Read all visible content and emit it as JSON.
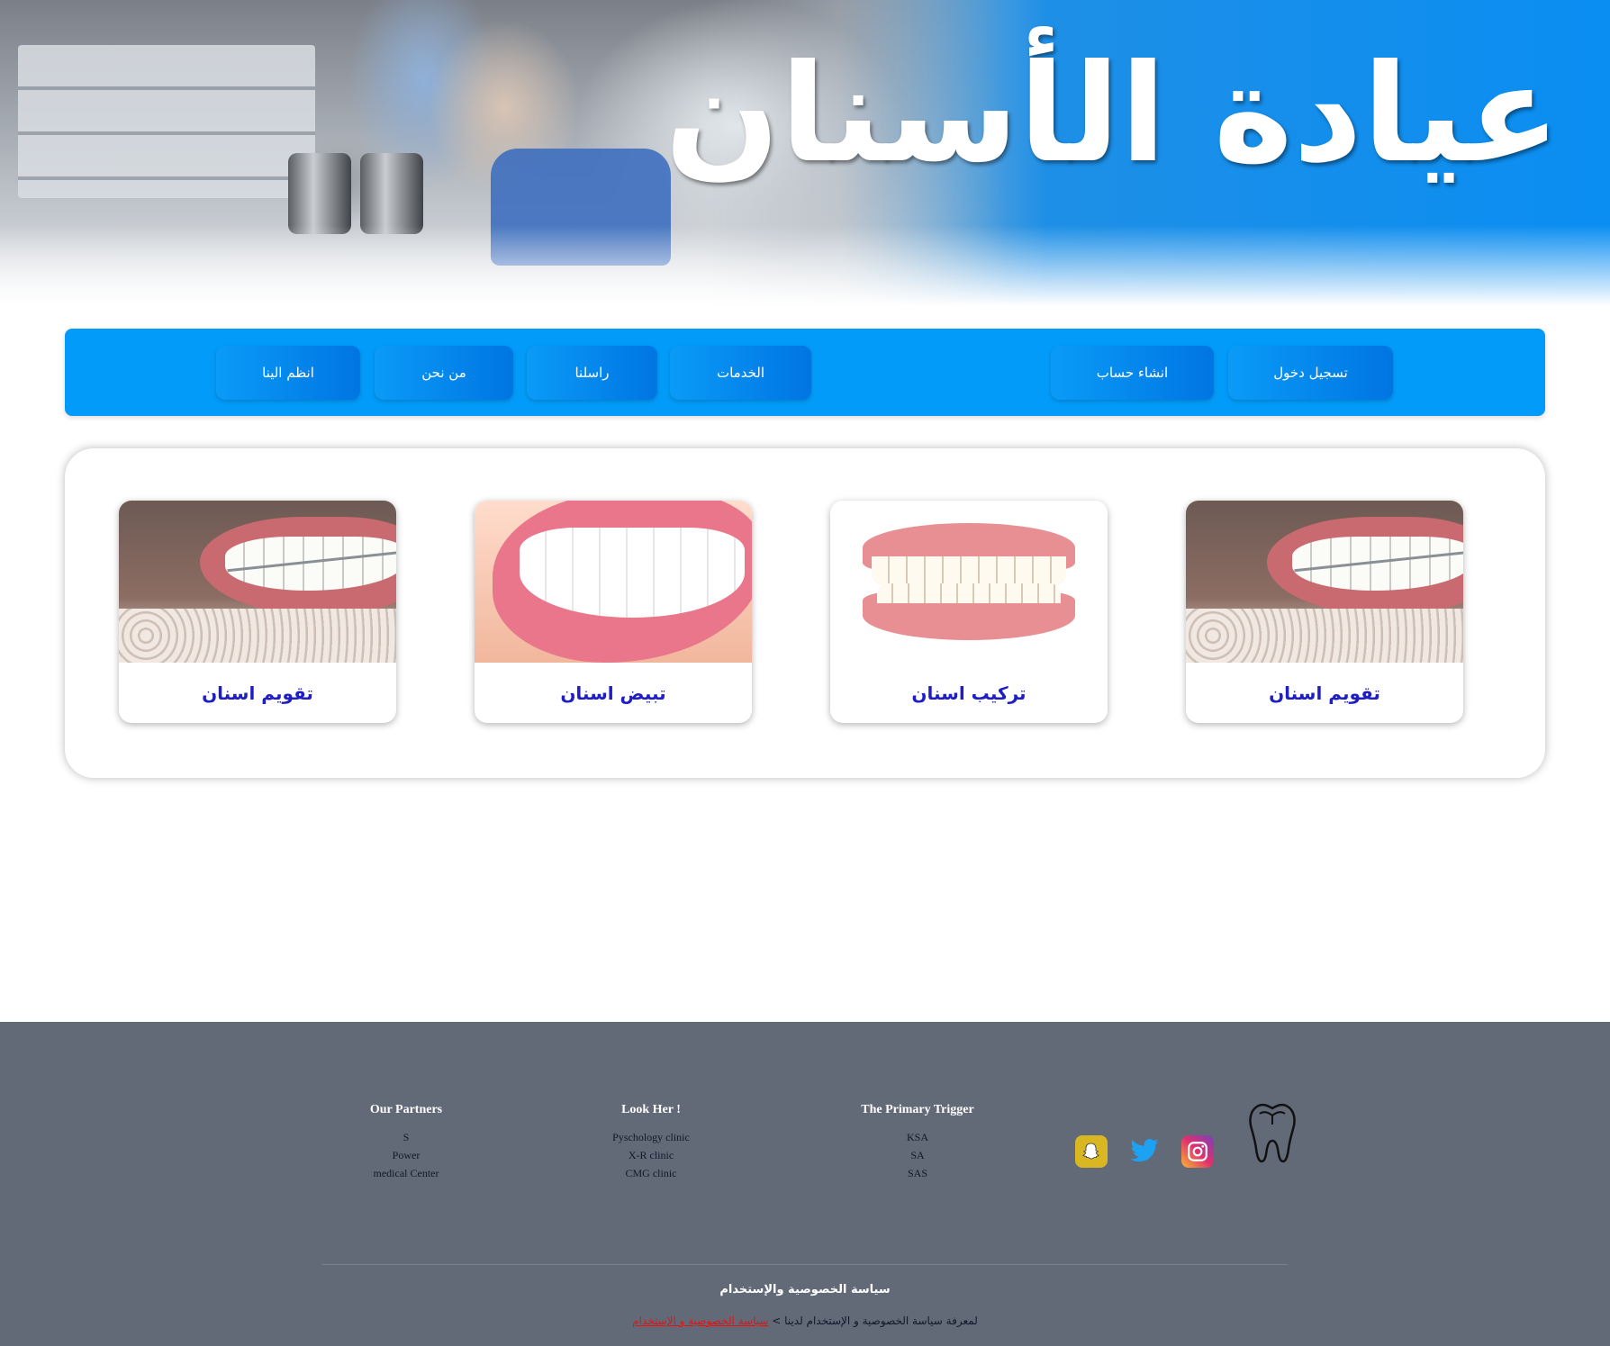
{
  "header": {
    "title": "عيادة الأسنان"
  },
  "nav": {
    "join": "انظم الينا",
    "about": "من نحن",
    "contact": "راسلنا",
    "services": "الخدمات",
    "register": "انشاء حساب",
    "login": "تسجيل دخول"
  },
  "services": {
    "cards": [
      {
        "title": "تقويم اسنان"
      },
      {
        "title": "تبيض اسنان"
      },
      {
        "title": "تركيب اسنان"
      },
      {
        "title": "تقويم اسنان"
      }
    ]
  },
  "footer": {
    "partners": {
      "heading": "Our Partners",
      "items": [
        "S",
        "Power",
        "medical Center"
      ]
    },
    "look": {
      "heading": "Look Her !",
      "items": [
        "Pyschology clinic",
        "X-R clinic",
        "CMG clinic"
      ]
    },
    "trigger": {
      "heading": "The Primary Trigger",
      "items": [
        "KSA",
        "SA",
        "SAS"
      ]
    },
    "social_icons": [
      "snapchat-icon",
      "twitter-icon",
      "instagram-icon"
    ],
    "logo_icon": "tooth-icon",
    "policy_title": "سياسة الخصوصية والإستخدام",
    "policy_text": "لمعرفة سياسة الخصوصية و الإستخدام لدينا >",
    "policy_link": "سياسة الخصوصية و الإستخدام"
  },
  "colors": {
    "nav_bg": "#039bf9",
    "footer_bg": "#626a78",
    "card_title": "#1f1ec4",
    "policy_link": "#e01414"
  }
}
